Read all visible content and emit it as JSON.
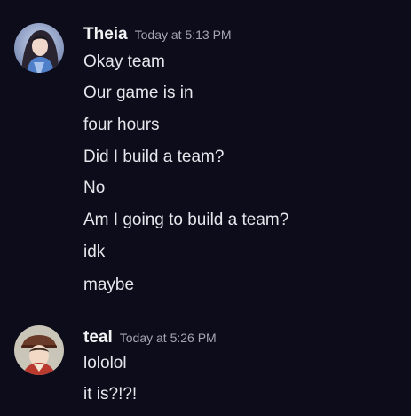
{
  "messages": [
    {
      "author": "Theia",
      "timestamp": "Today at 5:13 PM",
      "avatar_icon": "user-avatar-theia",
      "lines": [
        "Okay team",
        "Our game is in",
        "four hours",
        "Did I build a team?",
        "No",
        "Am I going to build a team?",
        "idk",
        "maybe"
      ]
    },
    {
      "author": "teal",
      "timestamp": "Today at 5:26 PM",
      "avatar_icon": "user-avatar-teal",
      "lines": [
        "lololol",
        "it is?!?!"
      ]
    }
  ],
  "colors": {
    "background": "#0d0c1a",
    "username": "#f2f3f5",
    "timestamp": "#a3a6b3",
    "message_text": "#e6e7ec"
  }
}
